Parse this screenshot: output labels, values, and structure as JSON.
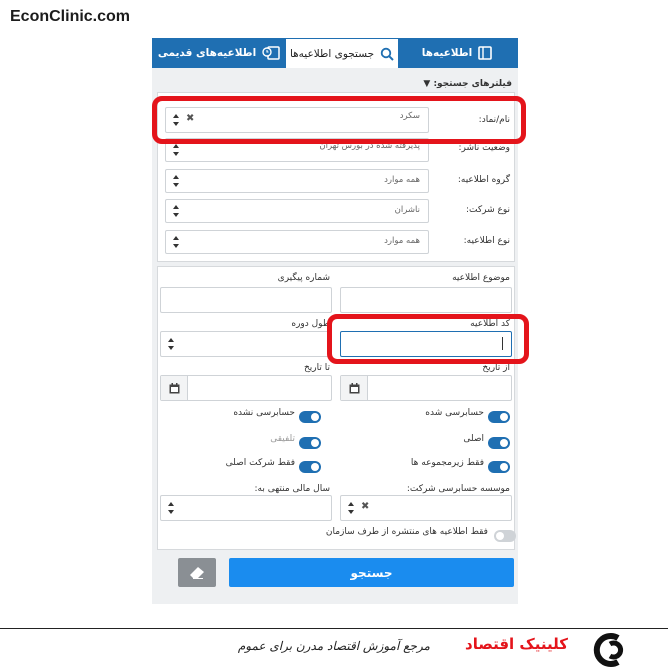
{
  "brand": "EconClinic.com",
  "tabs": [
    {
      "label": "اطلاعیه‌ها",
      "icon": "book-icon"
    },
    {
      "label": "جستجوی اطلاعیه‌ها",
      "icon": "search-icon"
    },
    {
      "label": "اطلاعیه‌های قدیمی",
      "icon": "clock-book-icon"
    }
  ],
  "filters_title": "فیلترهای جستجو:",
  "symbol": {
    "label": "نام/نماد:",
    "value": "سکرد"
  },
  "publisher_status": {
    "label": "وضعیت ناشر:",
    "value": "پذیرفته شده در بورس تهران"
  },
  "notice_group": {
    "label": "گروه اطلاعیه:",
    "value": "همه موارد"
  },
  "company_type": {
    "label": "نوع شرکت:",
    "value": "ناشران"
  },
  "notice_type": {
    "label": "نوع اطلاعیه:",
    "value": "همه موارد"
  },
  "notice_subject": {
    "label": "موضوع اطلاعیه",
    "value": ""
  },
  "tracking_number": {
    "label": "شماره پیگیری",
    "value": ""
  },
  "notice_code": {
    "label": "کد اطلاعیه",
    "value": ""
  },
  "period_length": {
    "label": "طول دوره",
    "value": ""
  },
  "from_date": {
    "label": "از تاریخ",
    "value": ""
  },
  "to_date": {
    "label": "تا تاریخ",
    "value": ""
  },
  "toggles": [
    {
      "label": "حسابرسی شده",
      "on": true
    },
    {
      "label": "حسابرسی نشده",
      "on": true
    },
    {
      "label": "اصلی",
      "on": true
    },
    {
      "label": "تلفیقی",
      "on": true
    },
    {
      "label": "فقط زیرمجموعه ها",
      "on": true
    },
    {
      "label": "فقط شرکت اصلی",
      "on": true
    }
  ],
  "audit_firm": {
    "label": "موسسه حسابرسی شرکت:",
    "value": ""
  },
  "fiscal_year": {
    "label": "سال مالی منتهی به:",
    "value": ""
  },
  "org_only": {
    "label": "فقط اطلاعیه های منتشره از طرف سازمان",
    "on": false
  },
  "search_button": "جستجو",
  "footer": {
    "title": "کلینیک اقتصاد",
    "subtitle": "مرجع آموزش اقتصاد مدرن برای عموم"
  },
  "colors": {
    "primary": "#1f6fb2",
    "button": "#1a8cef",
    "highlight": "#e4141b"
  }
}
